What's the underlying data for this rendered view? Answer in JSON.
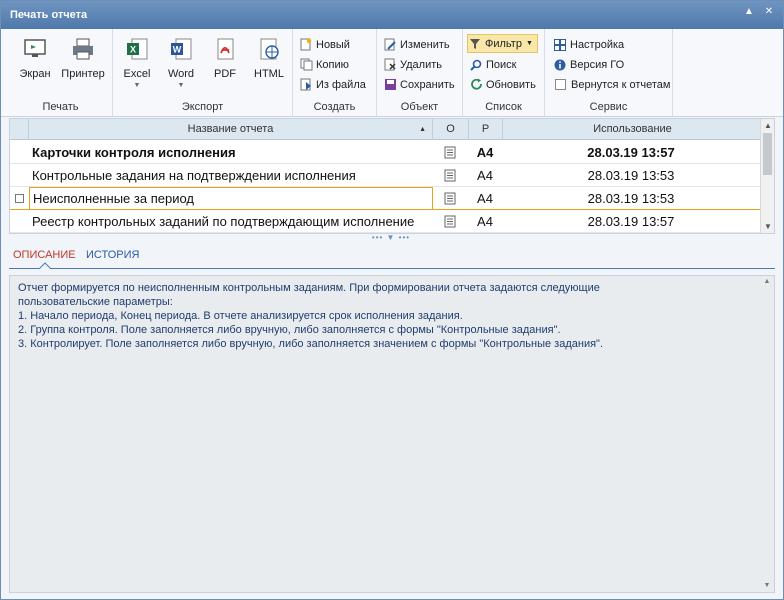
{
  "window": {
    "title": "Печать отчета",
    "pin_icon": "pin-icon",
    "close_icon": "close-icon"
  },
  "ribbon": {
    "print": {
      "label": "Печать",
      "screen": "Экран",
      "printer": "Принтер"
    },
    "export": {
      "label": "Экспорт",
      "excel": "Excel",
      "word": "Word",
      "pdf": "PDF",
      "html": "HTML"
    },
    "create": {
      "label": "Создать",
      "new": "Новый",
      "copy": "Копию",
      "from_file": "Из файла"
    },
    "object": {
      "label": "Объект",
      "edit": "Изменить",
      "delete": "Удалить",
      "save": "Сохранить"
    },
    "search": {
      "label": "Список",
      "filter": "Фильтр",
      "find": "Поиск",
      "refresh": "Обновить"
    },
    "service": {
      "label": "Сервис",
      "settings": "Настройка",
      "version": "Версия ГО",
      "back": "Вернутся к отчетам"
    }
  },
  "grid": {
    "headers": {
      "name": "Название отчета",
      "o": "О",
      "r": "Р",
      "usage": "Использование"
    },
    "rows": [
      {
        "name": "Карточки контроля исполнения",
        "r": "А4",
        "usage": "28.03.19 13:57"
      },
      {
        "name": "Контрольные задания на подтверждении исполнения",
        "r": "А4",
        "usage": "28.03.19 13:53"
      },
      {
        "name": "Неисполненные за период",
        "r": "А4",
        "usage": "28.03.19 13:53"
      },
      {
        "name": "Реестр контрольных заданий по подтверждающим исполнение",
        "r": "А4",
        "usage": "28.03.19 13:57"
      }
    ]
  },
  "tabs": {
    "description": "ОПИСАНИЕ",
    "history": "ИСТОРИЯ"
  },
  "description": {
    "text": "Отчет формируется по неисполненным контрольным заданиям. При формировании отчета задаются следующие\nпользовательские параметры:\n1. Начало периода, Конец периода. В отчете анализируется срок исполнения задания.\n2. Группа контроля. Поле заполняется либо вручную, либо заполняется с формы \"Контрольные задания\".\n3. Контролирует. Поле заполняется либо вручную, либо заполняется значением с формы \"Контрольные задания\"."
  },
  "colors": {
    "accent": "#4f79ab",
    "selection": "#e8a317",
    "active_tab": "#c0392b",
    "link": "#2b5da3"
  }
}
